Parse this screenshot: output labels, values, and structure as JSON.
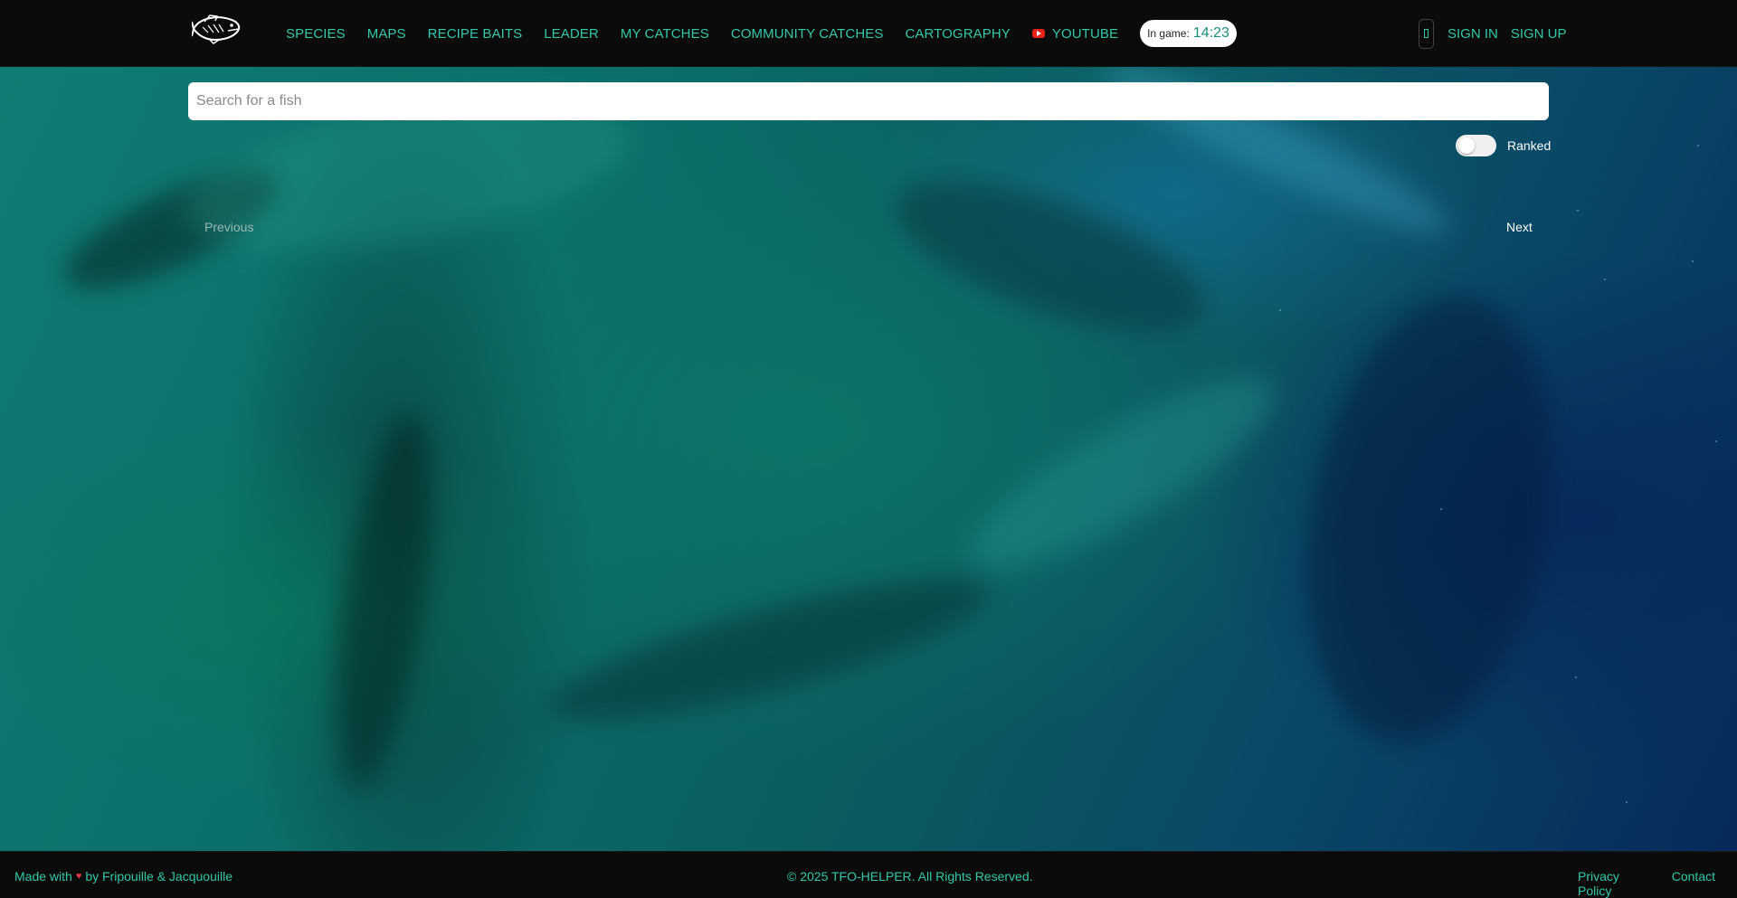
{
  "header": {
    "logo_icon": "bass-fish-icon",
    "nav": [
      {
        "label": "SPECIES"
      },
      {
        "label": "MAPS"
      },
      {
        "label": "RECIPE BAITS"
      },
      {
        "label": "LEADER"
      },
      {
        "label": "MY CATCHES"
      },
      {
        "label": "COMMUNITY CATCHES"
      },
      {
        "label": "CARTOGRAPHY"
      },
      {
        "label": "YOUTUBE",
        "icon": "youtube-icon"
      }
    ],
    "ingame": {
      "label": "In game:",
      "time": "14:23"
    },
    "sign_in": "SIGN IN",
    "sign_up": "SIGN UP",
    "accent_color": "#34c7a8"
  },
  "main": {
    "search": {
      "placeholder": "Search for a fish",
      "value": ""
    },
    "ranked_toggle": {
      "label": "Ranked",
      "checked": false
    },
    "pagination": {
      "previous": "Previous",
      "next": "Next"
    }
  },
  "footer": {
    "made_with_prefix": "Made with",
    "heart_icon": "heart-icon",
    "made_with_suffix": "by Fripouille & Jacquouille",
    "copyright": "© 2025 TFO-HELPER. All Rights Reserved.",
    "links": [
      {
        "label": "Privacy Policy"
      },
      {
        "label": "Contact"
      }
    ]
  }
}
